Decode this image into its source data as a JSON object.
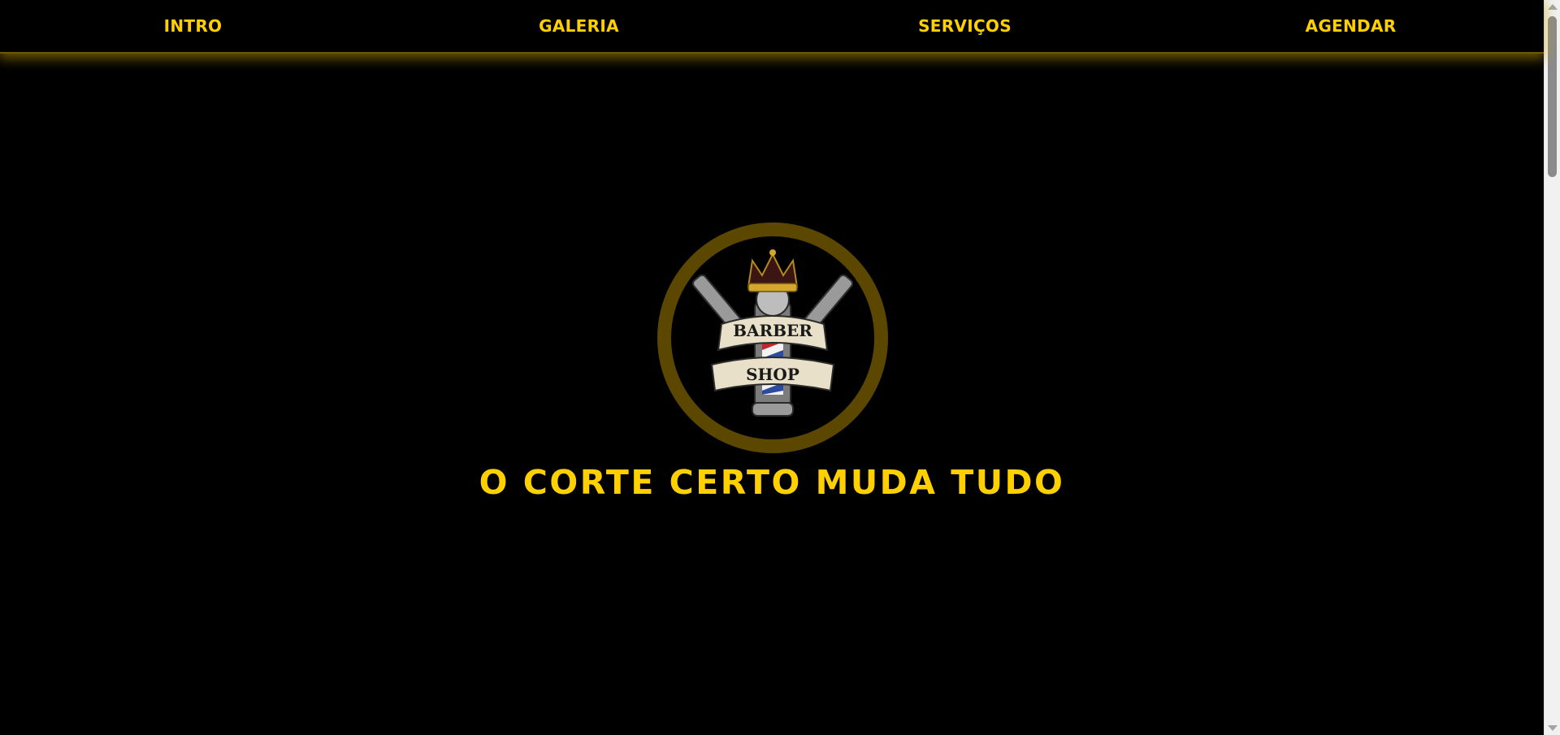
{
  "nav": {
    "items": [
      {
        "label": "INTRO"
      },
      {
        "label": "GALERIA"
      },
      {
        "label": "SERVIÇOS"
      },
      {
        "label": "AGENDAR"
      }
    ]
  },
  "hero": {
    "logo": {
      "icon": "barber-shop-logo-icon",
      "line1": "BARBER",
      "line2": "SHOP"
    },
    "tagline": "O CORTE CERTO MUDA TUDO"
  },
  "colors": {
    "background": "#000000",
    "accent": "#ffd000",
    "ring": "#5b4700",
    "glow": "#c8a000"
  }
}
